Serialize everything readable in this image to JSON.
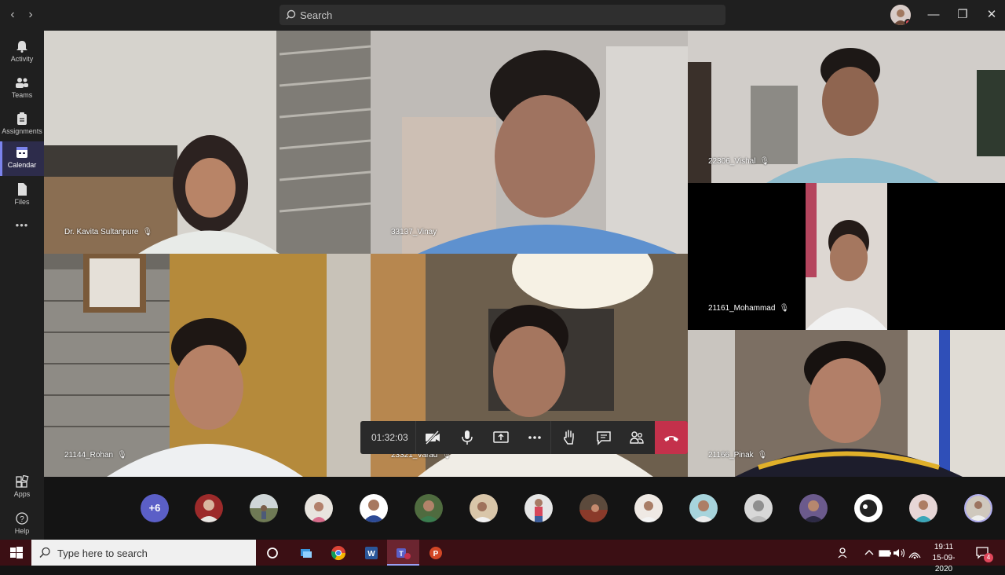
{
  "window": {
    "search_placeholder": "Search",
    "minimize": "—",
    "restore": "❐",
    "close": "✕"
  },
  "rail": {
    "items": [
      {
        "label": "Activity",
        "icon": "bell-icon"
      },
      {
        "label": "Teams",
        "icon": "teams-icon"
      },
      {
        "label": "Assignments",
        "icon": "assignments-icon"
      },
      {
        "label": "Calendar",
        "icon": "calendar-icon",
        "active": true
      },
      {
        "label": "Files",
        "icon": "files-icon"
      }
    ],
    "more": "•••",
    "apps_label": "Apps",
    "help_label": "Help"
  },
  "participants": [
    {
      "name": "Dr. Kavita Sultanpure",
      "muted": true
    },
    {
      "name": "33137_Vinay",
      "muted": false
    },
    {
      "name": "22306_Vishal",
      "muted": true
    },
    {
      "name": "21161_Mohammad",
      "muted": true
    },
    {
      "name": "21144_Rohan",
      "muted": true
    },
    {
      "name": "23321_Varad",
      "muted": true
    },
    {
      "name": "21166_Pinak",
      "muted": true
    }
  ],
  "controls": {
    "timer": "01:32:03",
    "camera": "camera-off-icon",
    "mic": "mic-icon",
    "share": "share-screen-icon",
    "more": "more-icon",
    "raise_hand": "raise-hand-icon",
    "chat": "chat-icon",
    "participants": "participants-icon",
    "hangup": "hang-up-icon",
    "hangup_color": "#c4314b"
  },
  "strip": {
    "overflow": "+6"
  },
  "taskbar": {
    "search_placeholder": "Type here to search",
    "time": "19:11",
    "date": "15-09-2020",
    "notifications": "4"
  }
}
